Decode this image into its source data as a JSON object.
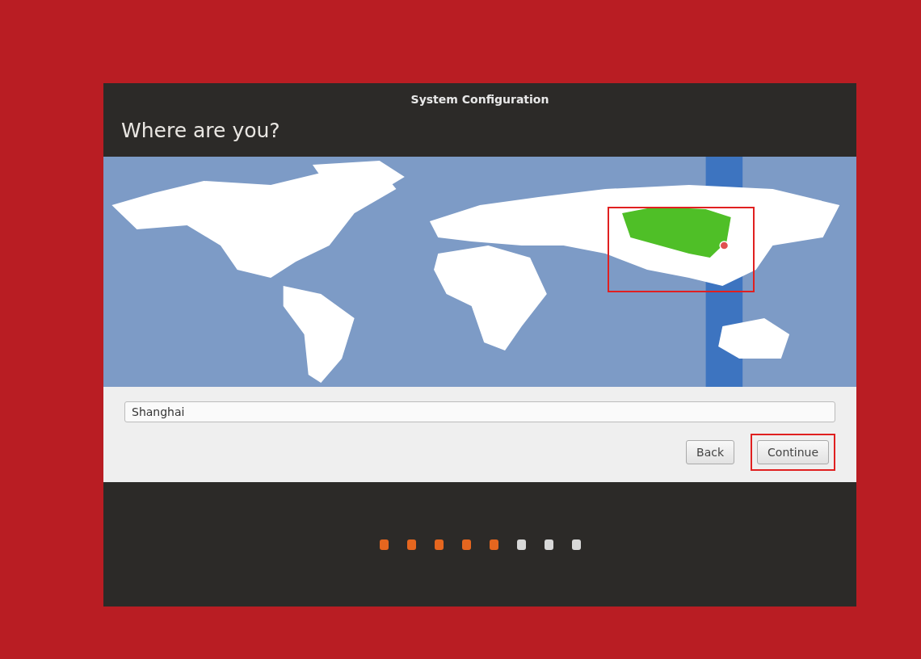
{
  "window": {
    "title": "System Configuration"
  },
  "heading": "Where are you?",
  "location_field": {
    "value": "Shanghai"
  },
  "buttons": [
    {
      "label": "Back",
      "highlighted": false
    },
    {
      "label": "Continue",
      "highlighted": true
    }
  ],
  "map": {
    "highlighted": true
  },
  "progress_steps": [
    {
      "done": true
    },
    {
      "done": true
    },
    {
      "done": true
    },
    {
      "done": true
    },
    {
      "done": true
    },
    {
      "done": false
    },
    {
      "done": false
    },
    {
      "done": false
    }
  ]
}
